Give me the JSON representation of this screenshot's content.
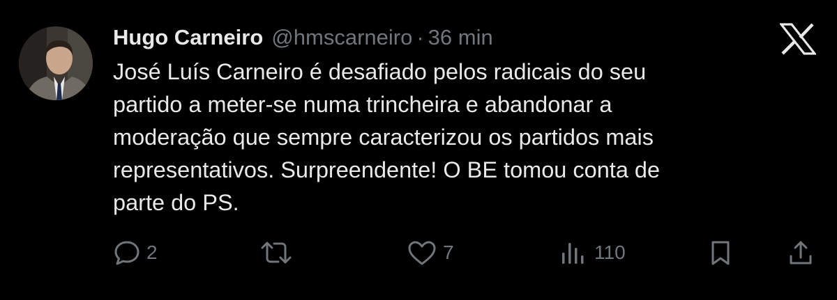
{
  "tweet": {
    "author": {
      "display_name": "Hugo Carneiro",
      "handle": "@hmscarneiro",
      "avatar_icon": "profile-photo"
    },
    "separator": "·",
    "time": "36 min",
    "text_lines": [
      "José Luís Carneiro é desafiado pelos radicais do seu",
      "partido a meter-se numa trincheira e abandonar a",
      "moderação que sempre caracterizou os partidos mais",
      "representativos. Surpreendente! O BE tomou conta de",
      "parte do PS."
    ],
    "brand_icon": "x-logo-icon",
    "actions": {
      "replies": "2",
      "retweets": "",
      "likes": "7",
      "views": "110"
    }
  },
  "colors": {
    "background": "#000000",
    "primary_text": "#e7e9ea",
    "secondary_text": "#71767b"
  }
}
